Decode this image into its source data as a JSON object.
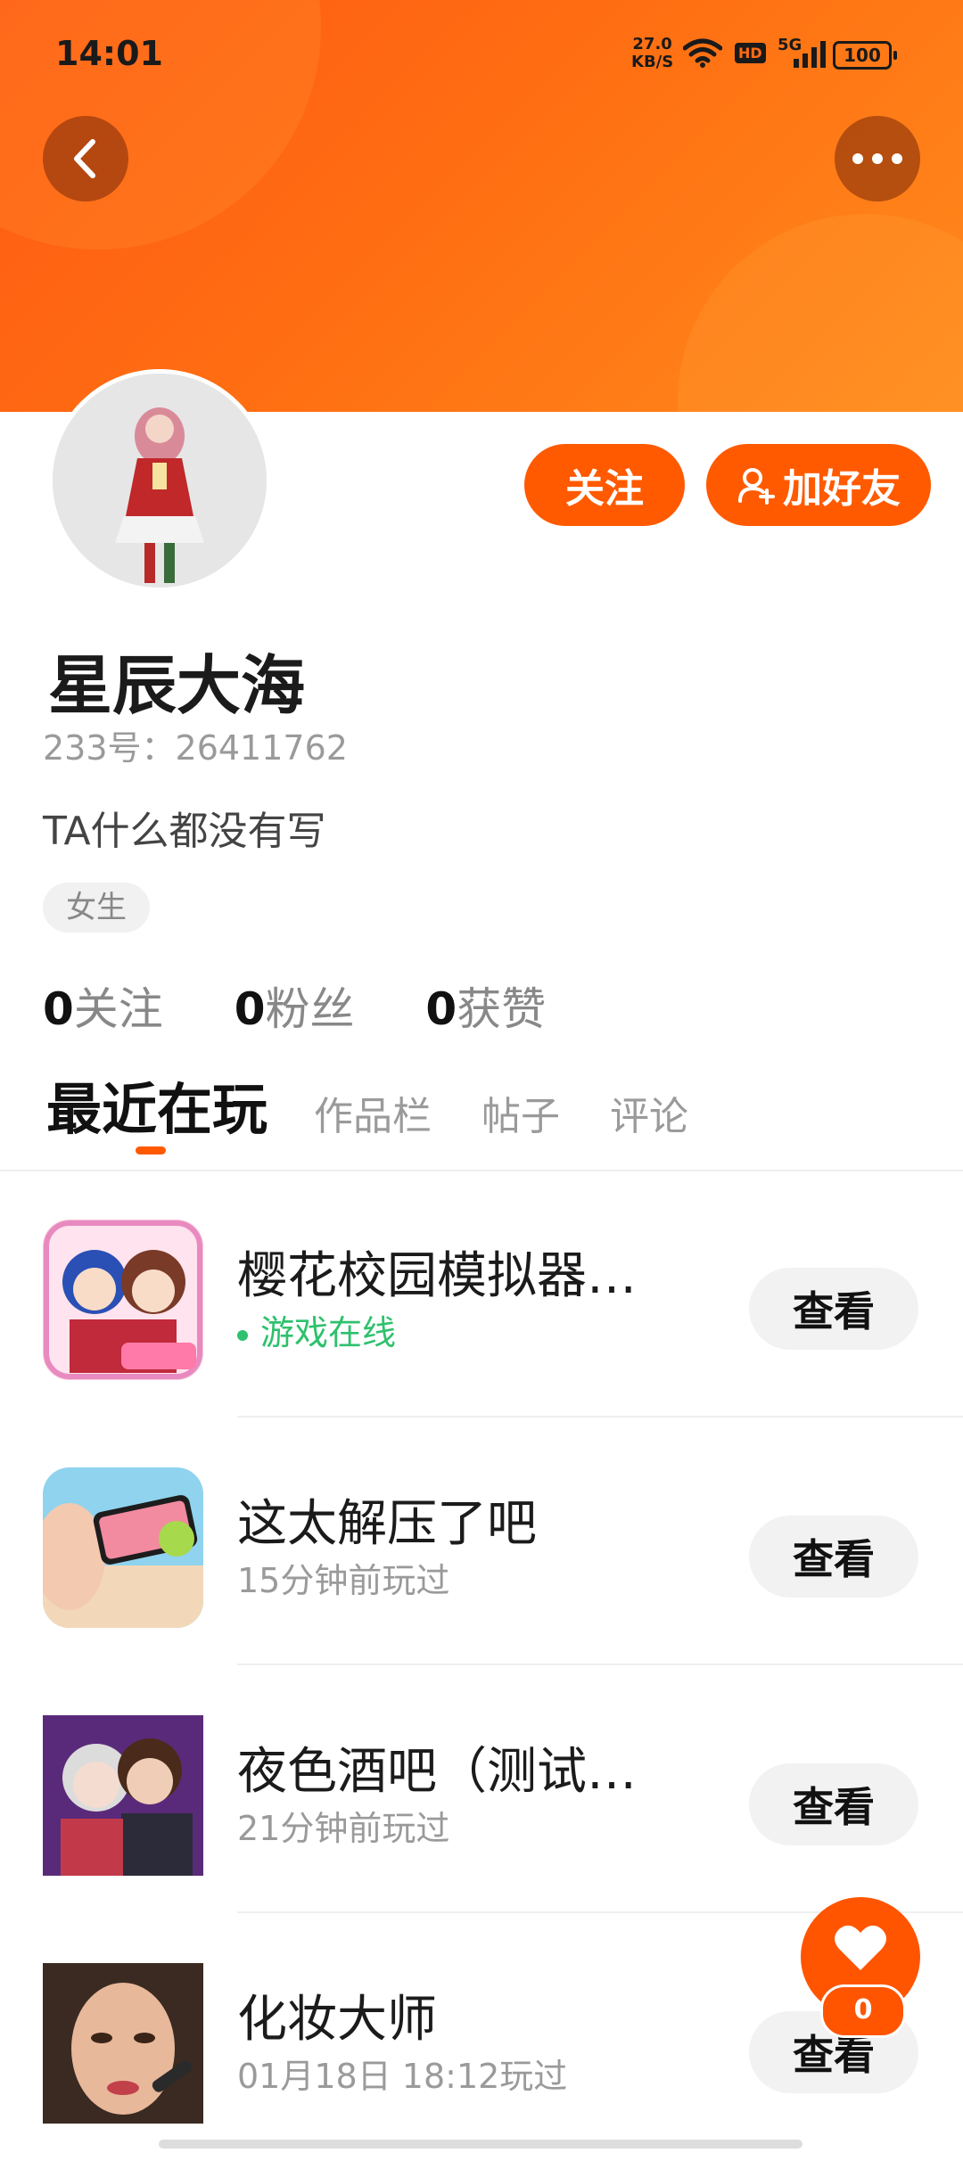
{
  "status_bar": {
    "time": "14:01",
    "net_speed": "27.0",
    "net_unit": "KB/S",
    "hd": "HD",
    "network": "5G",
    "battery": "100"
  },
  "header": {
    "back_icon": "chevron-left-icon",
    "more_icon": "more-dots-icon",
    "colors": {
      "header_start": "#ff5a14",
      "header_end": "#ff8a1c",
      "accent": "#ff5a00",
      "online": "#2fc16d"
    }
  },
  "profile": {
    "username": "星辰大海",
    "uid": "233号：26411762",
    "bio": "TA什么都没有写",
    "gender_tag": "女生",
    "follow_label": "关注",
    "add_friend_label": "加好友",
    "stats": [
      {
        "count": "0",
        "label": "关注"
      },
      {
        "count": "0",
        "label": "粉丝"
      },
      {
        "count": "0",
        "label": "获赞"
      }
    ]
  },
  "tabs": [
    "最近在玩",
    "作品栏",
    "帖子",
    "评论"
  ],
  "games": [
    {
      "title": "樱花校园模拟器测试版",
      "status": "游戏在线",
      "online": true,
      "button": "查看"
    },
    {
      "title": "这太解压了吧",
      "status": "15分钟前玩过",
      "online": false,
      "button": "查看"
    },
    {
      "title": "夜色酒吧（测试版）",
      "status": "21分钟前玩过",
      "online": false,
      "button": "查看"
    },
    {
      "title": "化妆大师",
      "status": "01月18日  18:12玩过",
      "online": false,
      "button": "查看"
    }
  ],
  "fab": {
    "icon": "heart-icon",
    "count": "0"
  }
}
